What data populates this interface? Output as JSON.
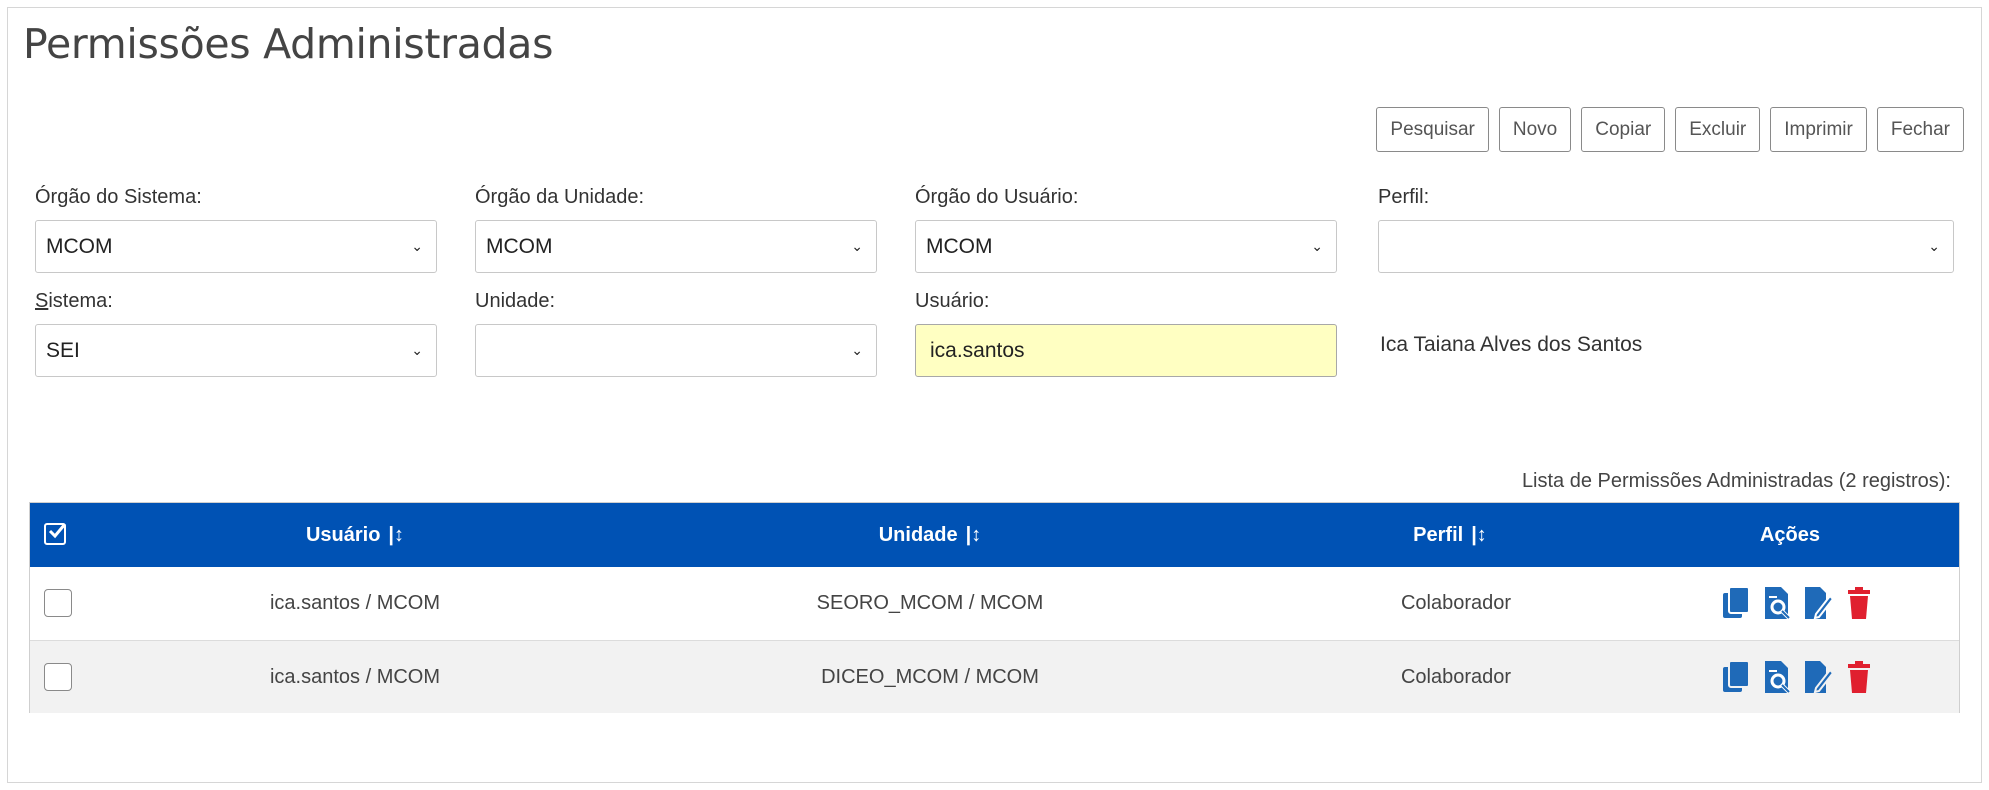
{
  "page": {
    "title": "Permissões Administradas"
  },
  "toolbar": {
    "buttons": [
      "Pesquisar",
      "Novo",
      "Copiar",
      "Excluir",
      "Imprimir",
      "Fechar"
    ]
  },
  "form": {
    "orgao_sistema": {
      "label": "Órgão do Sistema:",
      "value": "MCOM"
    },
    "orgao_unidade": {
      "label": "Órgão da Unidade:",
      "value": "MCOM"
    },
    "orgao_usuario": {
      "label": "Órgão do Usuário:",
      "value": "MCOM"
    },
    "perfil": {
      "label": "Perfil:",
      "value": ""
    },
    "sistema": {
      "label_access_key": "S",
      "label_rest": "istema:",
      "value": "SEI"
    },
    "unidade": {
      "label": "Unidade:",
      "value": ""
    },
    "usuario": {
      "label": "Usuário:",
      "value": "ica.santos"
    },
    "usuario_nome": "Ica Taiana Alves dos Santos"
  },
  "table": {
    "caption": "Lista de Permissões Administradas (2 registros):",
    "columns": {
      "usuario": "Usuário",
      "unidade": "Unidade",
      "perfil": "Perfil",
      "acoes": "Ações"
    },
    "sort_glyph": "|↕",
    "rows": [
      {
        "usuario": "ica.santos / MCOM",
        "unidade": "SEORO_MCOM / MCOM",
        "perfil": "Colaborador"
      },
      {
        "usuario": "ica.santos / MCOM",
        "unidade": "DICEO_MCOM / MCOM",
        "perfil": "Colaborador"
      }
    ]
  },
  "icons": {
    "select_chevron": "chevron-down-icon",
    "actions": [
      "copy-icon",
      "view-icon",
      "edit-icon",
      "delete-icon"
    ]
  },
  "colors": {
    "header_bg": "#0052b4",
    "action_icon": "#1f6ab8",
    "delete_icon": "#e0202f",
    "highlight_input": "#ffffc2"
  }
}
